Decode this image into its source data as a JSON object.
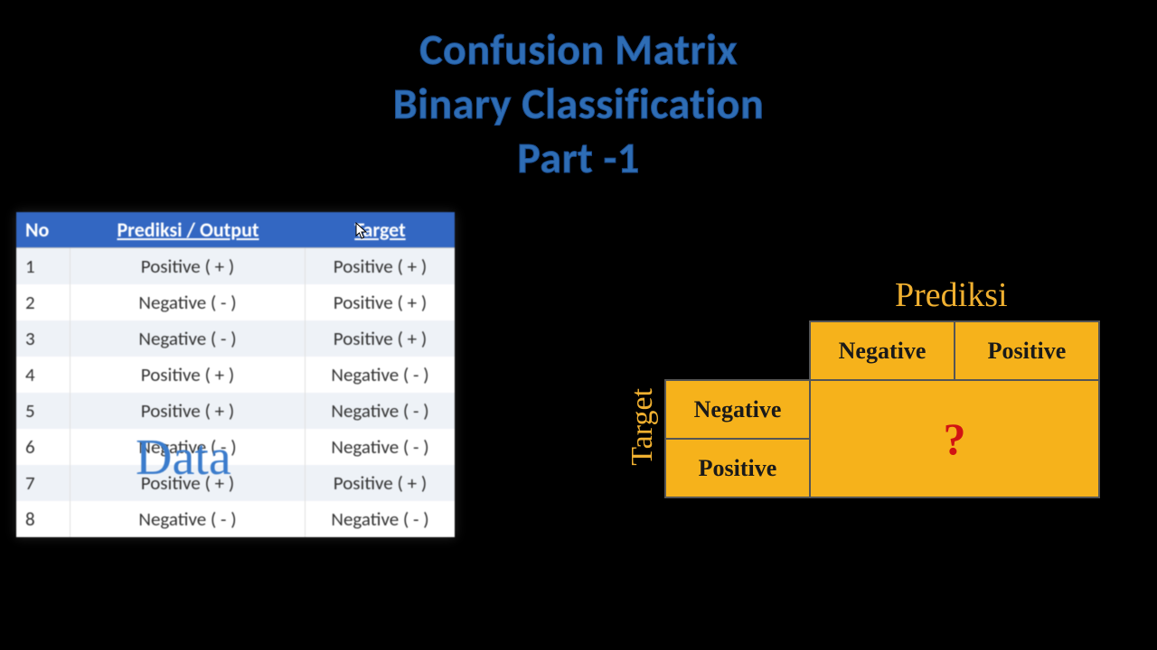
{
  "title": {
    "line1": "Confusion Matrix",
    "line2": "Binary Classification",
    "line3": "Part -1"
  },
  "data_table": {
    "headers": {
      "no": "No",
      "pred": "Prediksi / Output",
      "target": "Target"
    },
    "rows": [
      {
        "no": "1",
        "pred": "Positive ( + )",
        "target": "Positive ( + )"
      },
      {
        "no": "2",
        "pred": "Negative ( - )",
        "target": "Positive ( + )"
      },
      {
        "no": "3",
        "pred": "Negative ( - )",
        "target": "Positive ( + )"
      },
      {
        "no": "4",
        "pred": "Positive ( + )",
        "target": "Negative ( - )"
      },
      {
        "no": "5",
        "pred": "Positive ( + )",
        "target": "Negative ( - )"
      },
      {
        "no": "6",
        "pred": "Negative ( - )",
        "target": "Negative ( - )"
      },
      {
        "no": "7",
        "pred": "Positive ( + )",
        "target": "Positive ( + )"
      },
      {
        "no": "8",
        "pred": "Negative ( - )",
        "target": "Negative ( - )"
      }
    ],
    "overlay_label": "Data"
  },
  "confusion_matrix": {
    "axis_pred": "Prediksi",
    "axis_target": "Target",
    "col_neg": "Negative",
    "col_pos": "Positive",
    "row_neg": "Negative",
    "row_pos": "Positive",
    "center_mark": "?"
  }
}
